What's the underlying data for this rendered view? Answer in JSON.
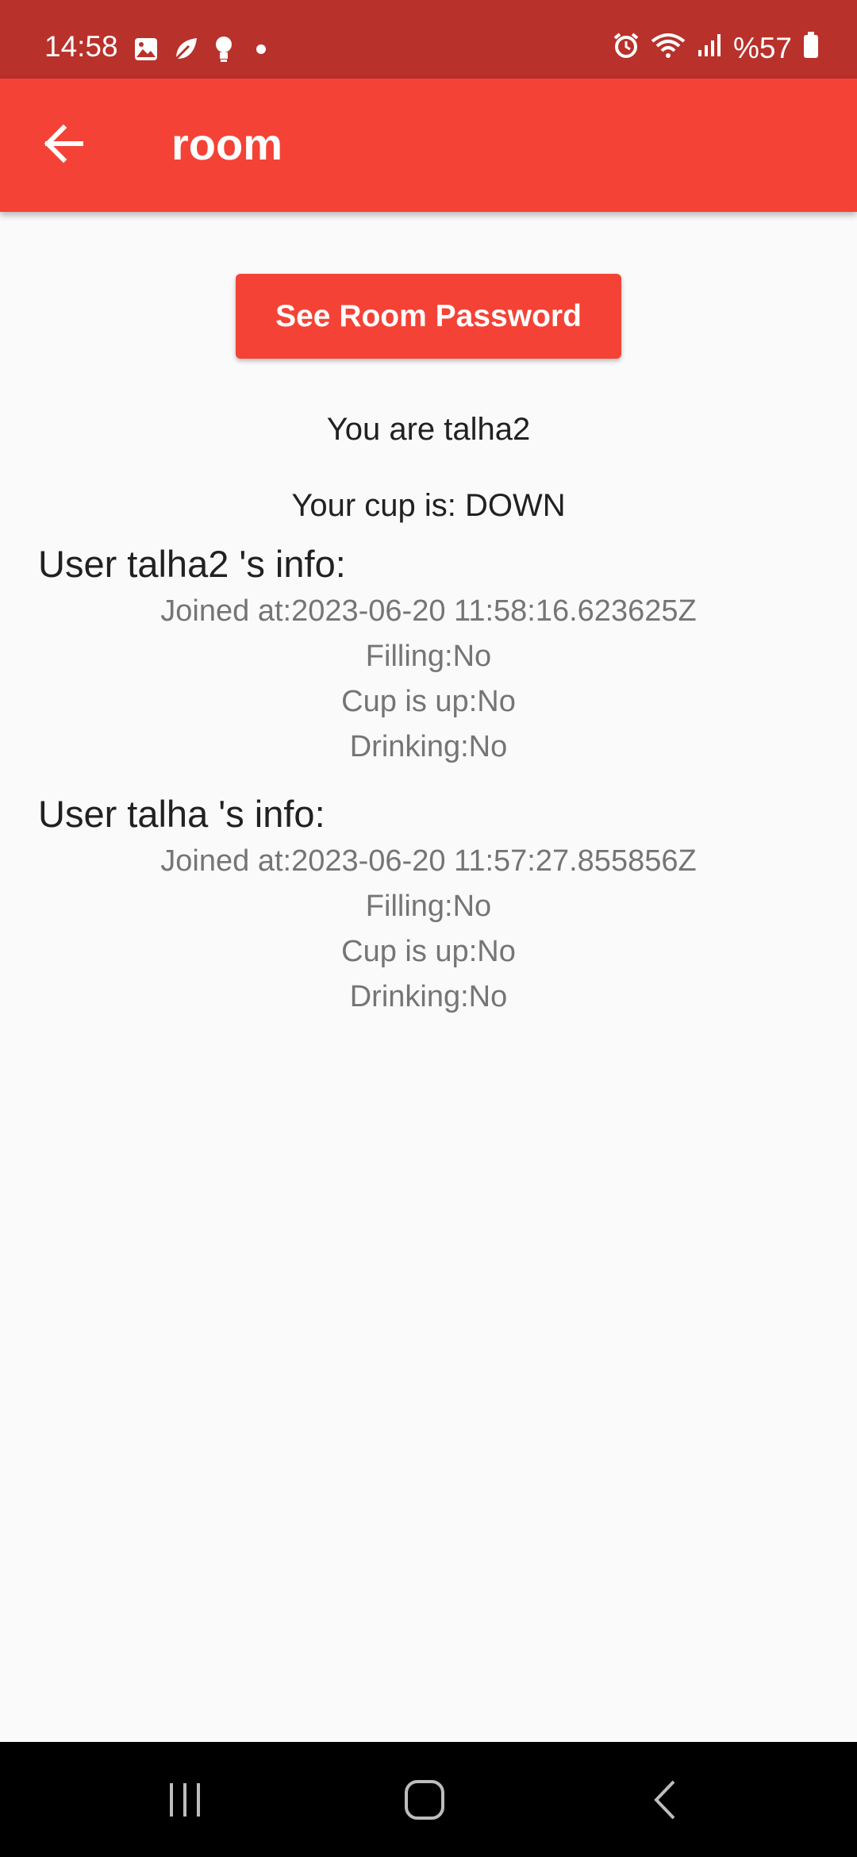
{
  "status_bar": {
    "time": "14:58",
    "battery": "%57",
    "icons": [
      "image-icon",
      "leaf-icon",
      "bulb-icon",
      "dot-icon",
      "alarm-icon",
      "wifi-icon",
      "signal-icon",
      "battery-icon"
    ]
  },
  "app_bar": {
    "title": "room",
    "back_icon": "arrow-left-icon"
  },
  "main": {
    "password_button_label": "See Room Password",
    "you_are": "You are talha2",
    "cup_status": "Your cup is: DOWN",
    "users": [
      {
        "heading": "User talha2 's info:",
        "joined": "Joined at:2023-06-20 11:58:16.623625Z",
        "filling": "Filling:No",
        "cup_up": "Cup is up:No",
        "drinking": "Drinking:No"
      },
      {
        "heading": "User talha 's info:",
        "joined": "Joined at:2023-06-20 11:57:27.855856Z",
        "filling": "Filling:No",
        "cup_up": "Cup is up:No",
        "drinking": "Drinking:No"
      }
    ]
  },
  "nav_bar": {
    "icons": [
      "recents-icon",
      "home-icon",
      "back-icon"
    ]
  },
  "colors": {
    "status_bar": "#B8312B",
    "app_bar": "#F44336",
    "button": "#F44336",
    "background": "#FAFAFA",
    "text_primary": "#212121",
    "text_secondary": "#757575",
    "nav_bar": "#000000"
  }
}
